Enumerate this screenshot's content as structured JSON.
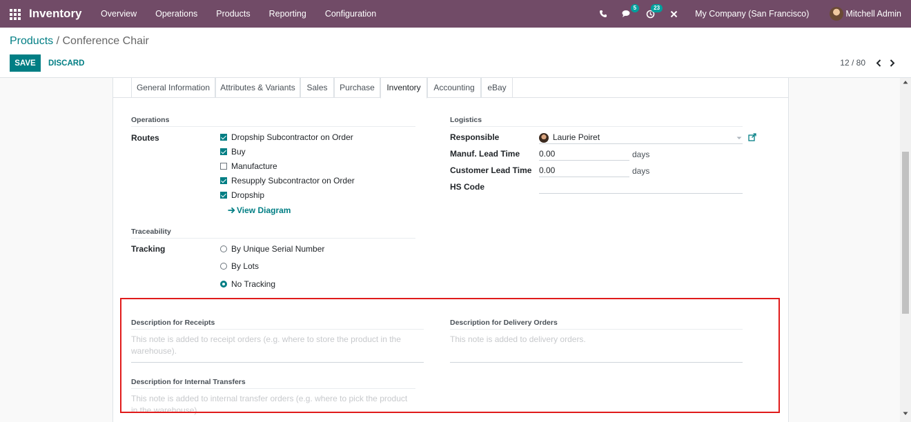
{
  "navbar": {
    "app_name": "Inventory",
    "menu": [
      "Overview",
      "Operations",
      "Products",
      "Reporting",
      "Configuration"
    ],
    "chat_badge": "5",
    "activity_badge": "23",
    "company": "My Company (San Francisco)",
    "user": "Mitchell Admin",
    "brand_color": "#714b67"
  },
  "breadcrumb": {
    "parent": "Products",
    "separator": " / ",
    "current": "Conference Chair"
  },
  "actions": {
    "save_label": "SAVE",
    "discard_label": "DISCARD"
  },
  "pager": {
    "value": "12 / 80"
  },
  "tabs": [
    "General Information",
    "Attributes & Variants",
    "Sales",
    "Purchase",
    "Inventory",
    "Accounting",
    "eBay"
  ],
  "active_tab": "Inventory",
  "operations": {
    "section_title": "Operations",
    "routes_label": "Routes",
    "routes": [
      {
        "label": "Dropship Subcontractor on Order",
        "checked": true
      },
      {
        "label": "Buy",
        "checked": true
      },
      {
        "label": "Manufacture",
        "checked": false
      },
      {
        "label": "Resupply Subcontractor on Order",
        "checked": true
      },
      {
        "label": "Dropship",
        "checked": true
      }
    ],
    "view_diagram": "View Diagram"
  },
  "traceability": {
    "section_title": "Traceability",
    "tracking_label": "Tracking",
    "options": [
      {
        "label": "By Unique Serial Number",
        "selected": false
      },
      {
        "label": "By Lots",
        "selected": false
      },
      {
        "label": "No Tracking",
        "selected": true
      }
    ]
  },
  "logistics": {
    "section_title": "Logistics",
    "responsible_label": "Responsible",
    "responsible_value": "Laurie Poiret",
    "manuf_lead_label": "Manuf. Lead Time",
    "manuf_lead_value": "0.00",
    "customer_lead_label": "Customer Lead Time",
    "customer_lead_value": "0.00",
    "days_unit": "days",
    "hs_code_label": "HS Code",
    "hs_code_value": ""
  },
  "descriptions": {
    "receipts_label": "Description for Receipts",
    "receipts_placeholder": "This note is added to receipt orders (e.g. where to store the product in the warehouse).",
    "delivery_label": "Description for Delivery Orders",
    "delivery_placeholder": "This note is added to delivery orders.",
    "internal_label": "Description for Internal Transfers",
    "internal_placeholder": "This note is added to internal transfer orders (e.g. where to pick the product in the warehouse)."
  },
  "icons": {
    "apps": "apps-grid-icon",
    "phone": "phone-icon",
    "chat": "chat-icon",
    "activity": "clock-icon",
    "debug": "close-icon",
    "pager_prev": "chevron-left-icon",
    "pager_next": "chevron-right-icon",
    "external": "external-link-icon",
    "dropdown": "caret-down-icon"
  },
  "colors": {
    "accent": "#017e84",
    "highlight": "#e01a1a"
  }
}
